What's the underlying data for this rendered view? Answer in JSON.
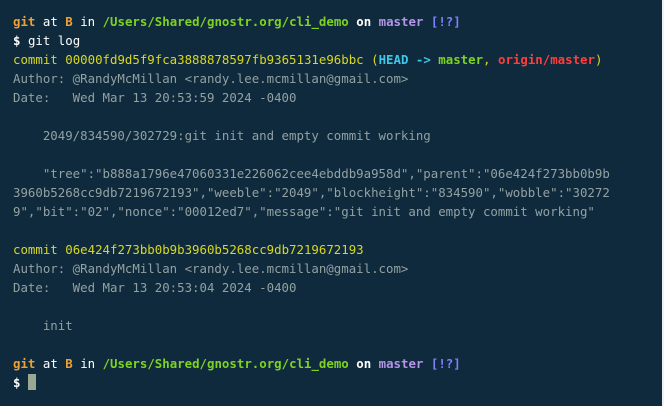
{
  "prompt1": {
    "cmd": "git",
    "at": "at",
    "branch_letter": "B",
    "in": "in",
    "path": "/Users/Shared/gnostr.org/cli_demo",
    "on": "on",
    "branch": "master",
    "status": "[!?]"
  },
  "command": {
    "sigil": "$",
    "text": "git log"
  },
  "commit1": {
    "label": "commit",
    "hash": "00000fd9d5f9fca3888878597fb9365131e96bbc",
    "refs_open": "(",
    "head": "HEAD",
    "arrow": "->",
    "local_branch": "master",
    "comma": ",",
    "remote_branch": "origin/master",
    "refs_close": ")",
    "author": "Author: @RandyMcMillan <randy.lee.mcmillan@gmail.com>",
    "date": "Date:   Wed Mar 13 20:53:59 2024 -0400",
    "subject": "    2049/834590/302729:git init and empty commit working",
    "body_line1": "    \"tree\":\"b888a1796e47060331e226062cee4ebddb9a958d\",\"parent\":\"06e424f273bb0b9b",
    "body_line2": "3960b5268cc9db7219672193\",\"weeble\":\"2049\",\"blockheight\":\"834590\",\"wobble\":\"30272",
    "body_line3": "9\",\"bit\":\"02\",\"nonce\":\"00012ed7\",\"message\":\"git init and empty commit working\""
  },
  "commit2": {
    "label": "commit",
    "hash": "06e424f273bb0b9b3960b5268cc9db7219672193",
    "author": "Author: @RandyMcMillan <randy.lee.mcmillan@gmail.com>",
    "date": "Date:   Wed Mar 13 20:53:04 2024 -0400",
    "subject": "    init"
  },
  "prompt2": {
    "cmd": "git",
    "at": "at",
    "branch_letter": "B",
    "in": "in",
    "path": "/Users/Shared/gnostr.org/cli_demo",
    "on": "on",
    "branch": "master",
    "status": "[!?]"
  },
  "input": {
    "sigil": "$",
    "value": ""
  },
  "colors": {
    "background": "#0f2a3d",
    "prompt_cmd": "#f0a030",
    "path": "#7ed321",
    "branch": "#b694e8",
    "commit_hash": "#d8d820",
    "head": "#3ec8e8",
    "remote": "#ff3d3d"
  }
}
